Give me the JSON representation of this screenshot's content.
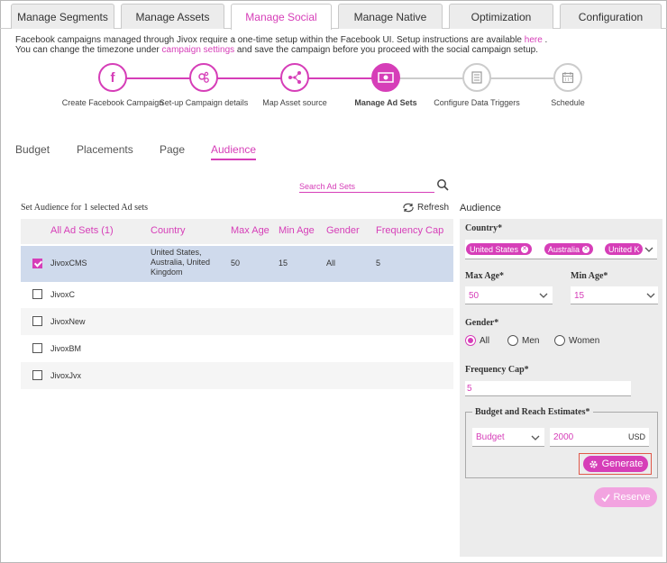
{
  "tabs": [
    "Manage Segments",
    "Manage Assets",
    "Manage Social",
    "Manage Native",
    "Optimization",
    "Configuration"
  ],
  "info": {
    "line1_pre": "Facebook campaigns managed through Jivox require a one-time setup within the Facebook UI. Setup instructions are available ",
    "line1_link": "here",
    "line1_post": " .",
    "line2_pre": "You can change the timezone under ",
    "line2_link": "campaign settings",
    "line2_post": " and save the campaign before you proceed with the social campaign setup."
  },
  "steps": [
    {
      "label": "Create Facebook Campaign",
      "icon": "facebook-icon"
    },
    {
      "label": "Set-up Campaign details",
      "icon": "gears-icon"
    },
    {
      "label": "Map Asset source",
      "icon": "network-icon"
    },
    {
      "label": "Manage Ad Sets",
      "icon": "money-icon"
    },
    {
      "label": "Configure Data Triggers",
      "icon": "list-icon"
    },
    {
      "label": "Schedule",
      "icon": "calendar-icon"
    }
  ],
  "subtabs": [
    "Budget",
    "Placements",
    "Page",
    "Audience"
  ],
  "search": {
    "placeholder": "Search Ad Sets"
  },
  "set_label": "Set Audience for 1 selected Ad sets",
  "refresh_label": "Refresh",
  "table": {
    "headers": [
      "All Ad Sets (1)",
      "Country",
      "Max Age",
      "Min Age",
      "Gender",
      "Frequency Cap"
    ],
    "rows": [
      {
        "name": "JivoxCMS",
        "country": "United States, Australia, United Kingdom",
        "max": "50",
        "min": "15",
        "gender": "All",
        "freq": "5",
        "checked": true
      },
      {
        "name": "JivoxC",
        "country": "",
        "max": "",
        "min": "",
        "gender": "",
        "freq": "",
        "checked": false
      },
      {
        "name": "JivoxNew",
        "country": "",
        "max": "",
        "min": "",
        "gender": "",
        "freq": "",
        "checked": false
      },
      {
        "name": "JivoxBM",
        "country": "",
        "max": "",
        "min": "",
        "gender": "",
        "freq": "",
        "checked": false
      },
      {
        "name": "JivoxJvx",
        "country": "",
        "max": "",
        "min": "",
        "gender": "",
        "freq": "",
        "checked": false
      }
    ]
  },
  "panel": {
    "title": "Audience",
    "country_label": "Country*",
    "countries": [
      "United States",
      "Australia",
      "United K"
    ],
    "max_age_label": "Max Age*",
    "max_age": "50",
    "min_age_label": "Min Age*",
    "min_age": "15",
    "gender_label": "Gender*",
    "genders": [
      "All",
      "Men",
      "Women"
    ],
    "freq_label": "Frequency Cap*",
    "freq": "5",
    "budget_legend": "Budget and Reach Estimates*",
    "budget_type": "Budget",
    "budget_value": "2000",
    "currency": "USD",
    "generate": "Generate",
    "reserve": "Reserve"
  },
  "colors": {
    "accent": "#d63eb8",
    "selected_row": "#cfdaec",
    "panel_bg": "#ececec"
  }
}
